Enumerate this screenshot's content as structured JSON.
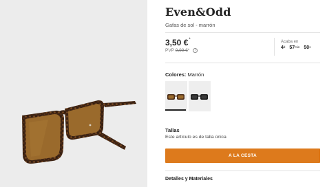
{
  "product": {
    "brand": "Even&Odd",
    "subtitle": "Gafas de sol - marrón"
  },
  "pricing": {
    "price": "3,50 €",
    "price_note": "*",
    "pvp_label": "PVP",
    "pvp_value": "9,99 €",
    "pvp_note": "*",
    "info_icon": "i"
  },
  "countdown": {
    "label": "Acaba en",
    "days": "4",
    "days_unit": "d",
    "hours": "57",
    "hours_unit": "min",
    "seconds": "50",
    "seconds_unit": "s"
  },
  "colors": {
    "label": "Colores:",
    "selected": "Marrón",
    "swatches": [
      {
        "name": "Marrón",
        "selected": true
      },
      {
        "name": "Negro",
        "selected": false
      }
    ]
  },
  "sizes": {
    "title": "Tallas",
    "text": "Este artículo es de talla única"
  },
  "actions": {
    "add_to_cart": "A LA CESTA"
  },
  "details": {
    "title": "Detalles y Materiales"
  },
  "style": {
    "accent": "#dd7a1c",
    "gallery_bg": "#ececec",
    "lens_brown": "#9a6a2c",
    "frame_tortoise": "#4a2c18"
  }
}
